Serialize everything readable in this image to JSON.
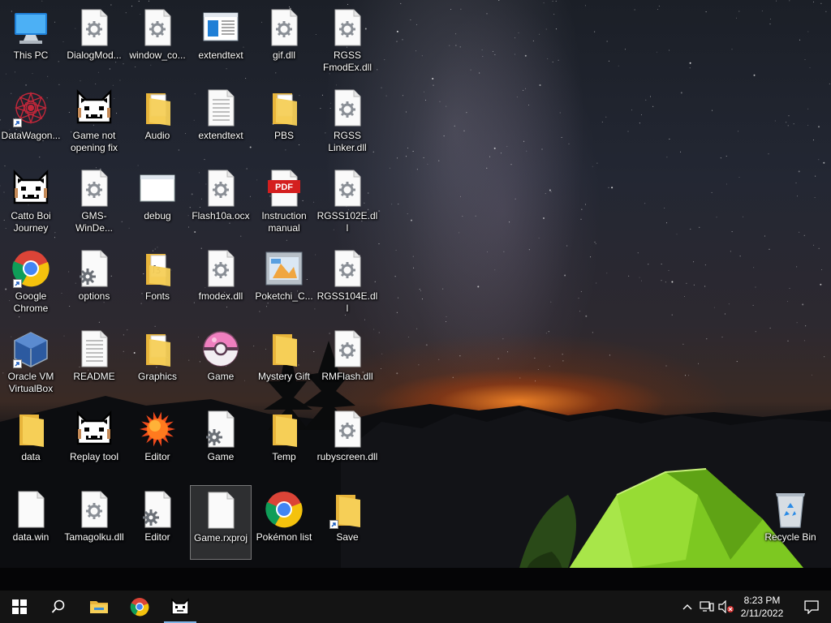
{
  "desktop": {
    "icons": [
      {
        "id": "this-pc",
        "label": "This PC",
        "kind": "computer"
      },
      {
        "id": "datawagon",
        "label": "DataWagon...",
        "kind": "datawagon",
        "shortcut": true
      },
      {
        "id": "catto-boi",
        "label": "Catto Boi Journey",
        "kind": "cat"
      },
      {
        "id": "google-chrome",
        "label": "Google Chrome",
        "kind": "chrome",
        "shortcut": true
      },
      {
        "id": "virtualbox",
        "label": "Oracle VM VirtualBox",
        "kind": "virtualbox",
        "shortcut": true
      },
      {
        "id": "data-folder",
        "label": "data",
        "kind": "folder"
      },
      {
        "id": "data-win",
        "label": "data.win",
        "kind": "blank"
      },
      {
        "id": "dialogmod",
        "label": "DialogMod...",
        "kind": "gear-file"
      },
      {
        "id": "game-not-opening",
        "label": "Game not opening fix",
        "kind": "cat"
      },
      {
        "id": "gms-winde",
        "label": "GMS-WinDe...",
        "kind": "gear-file"
      },
      {
        "id": "options",
        "label": "options",
        "kind": "config"
      },
      {
        "id": "readme",
        "label": "README",
        "kind": "text"
      },
      {
        "id": "replay-tool",
        "label": "Replay tool",
        "kind": "cat"
      },
      {
        "id": "tamagolku",
        "label": "Tamagolku.dll",
        "kind": "gear-file"
      },
      {
        "id": "window-co",
        "label": "window_co...",
        "kind": "gear-file"
      },
      {
        "id": "audio",
        "label": "Audio",
        "kind": "folder-docs"
      },
      {
        "id": "debug",
        "label": "debug",
        "kind": "window"
      },
      {
        "id": "fonts",
        "label": "Fonts",
        "kind": "folder-fonts"
      },
      {
        "id": "graphics",
        "label": "Graphics",
        "kind": "folder-docs"
      },
      {
        "id": "editor-sun",
        "label": "Editor",
        "kind": "sun"
      },
      {
        "id": "editor-cfg",
        "label": "Editor",
        "kind": "config"
      },
      {
        "id": "extendtext-app",
        "label": "extendtext",
        "kind": "app-window"
      },
      {
        "id": "extendtext-txt",
        "label": "extendtext",
        "kind": "text"
      },
      {
        "id": "flash10a",
        "label": "Flash10a.ocx",
        "kind": "gear-file"
      },
      {
        "id": "fmodex",
        "label": "fmodex.dll",
        "kind": "gear-file"
      },
      {
        "id": "game-ball",
        "label": "Game",
        "kind": "pokeball"
      },
      {
        "id": "game-cfg",
        "label": "Game",
        "kind": "config"
      },
      {
        "id": "game-rxproj",
        "label": "Game.rxproj",
        "kind": "blank",
        "selected": true
      },
      {
        "id": "gif-dll",
        "label": "gif.dll",
        "kind": "gear-file"
      },
      {
        "id": "pbs",
        "label": "PBS",
        "kind": "folder-docs"
      },
      {
        "id": "instruction-manual",
        "label": "Instruction manual",
        "kind": "pdf"
      },
      {
        "id": "poketchi",
        "label": "Poketchi_C...",
        "kind": "rmxp"
      },
      {
        "id": "mystery-gift",
        "label": "Mystery Gift",
        "kind": "folder"
      },
      {
        "id": "temp",
        "label": "Temp",
        "kind": "folder"
      },
      {
        "id": "pokemon-list",
        "label": "Pokémon list",
        "kind": "chrome"
      },
      {
        "id": "rgss-fmodex",
        "label": "RGSS FmodEx.dll",
        "kind": "gear-file"
      },
      {
        "id": "rgss-linker",
        "label": "RGSS Linker.dll",
        "kind": "gear-file"
      },
      {
        "id": "rgss102e",
        "label": "RGSS102E.dll",
        "kind": "gear-file"
      },
      {
        "id": "rgss104e",
        "label": "RGSS104E.dll",
        "kind": "gear-file"
      },
      {
        "id": "rmflash",
        "label": "RMFlash.dll",
        "kind": "gear-file"
      },
      {
        "id": "rubyscreen",
        "label": "rubyscreen.dll",
        "kind": "gear-file"
      },
      {
        "id": "save",
        "label": "Save",
        "kind": "folder",
        "shortcut": true
      },
      {
        "id": "recycle-bin",
        "label": "Recycle Bin",
        "kind": "recycle"
      }
    ]
  },
  "taskbar": {
    "pinned": [
      {
        "name": "start-button",
        "icon": "windows-logo-icon"
      },
      {
        "name": "search-button",
        "icon": "search-icon"
      },
      {
        "name": "file-explorer-button",
        "icon": "folder-icon"
      },
      {
        "name": "chrome-button",
        "icon": "chrome-icon"
      },
      {
        "name": "game-button",
        "icon": "cat-icon",
        "active": true
      }
    ],
    "tray": {
      "chevron_icon": "chevron-up-icon",
      "network_icon": "network-icon",
      "volume_icon": "volume-muted-icon",
      "notification_icon": "notification-icon"
    },
    "clock": {
      "time": "8:23 PM",
      "date": "2/11/2022"
    }
  },
  "colors": {
    "taskbar": "#141414",
    "active_indicator": "#7fb4e6",
    "folder": "#f3c84b",
    "pdf_red": "#d41f1f"
  }
}
